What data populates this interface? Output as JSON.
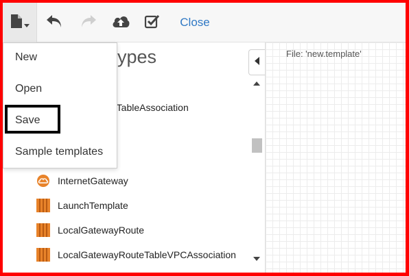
{
  "toolbar": {
    "file_icon": "file-icon",
    "undo_icon": "undo-icon",
    "redo_icon": "redo-icon",
    "upload_icon": "cloud-upload-icon",
    "validate_icon": "validate-checkbox-icon",
    "close_label": "Close"
  },
  "file_menu": {
    "items": [
      {
        "label": "New"
      },
      {
        "label": "Open"
      },
      {
        "label": "Save"
      },
      {
        "label": "Sample templates"
      }
    ]
  },
  "resource_panel": {
    "heading": "ypes",
    "partial_item": "teTableAssociation",
    "items": [
      {
        "label": "InternetGateway",
        "icon": "internet-gateway-icon"
      },
      {
        "label": "LaunchTemplate",
        "icon": "ec2-resource-icon"
      },
      {
        "label": "LocalGatewayRoute",
        "icon": "ec2-resource-icon"
      },
      {
        "label": "LocalGatewayRouteTableVPCAssociation",
        "icon": "ec2-resource-icon"
      }
    ]
  },
  "canvas": {
    "file_label": "File: 'new.template'"
  },
  "colors": {
    "accent": "#2f78c4",
    "frame": "#ff0000",
    "resource_orange": "#e8832a"
  }
}
